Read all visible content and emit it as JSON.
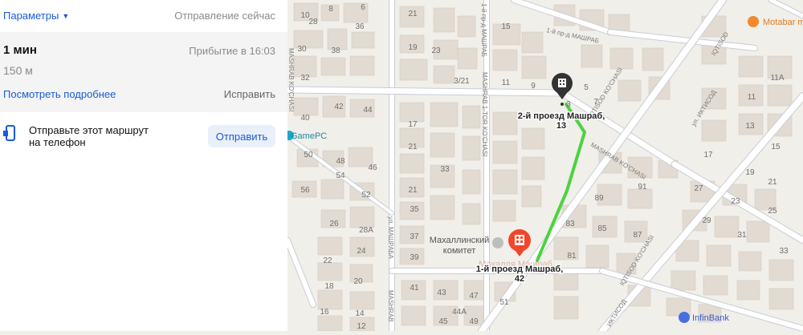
{
  "panel": {
    "params_label": "Параметры",
    "depart_label": "Отправление сейчас",
    "route": {
      "duration": "1 мин",
      "arrival": "Прибытие в 16:03",
      "distance": "150 м",
      "details_link": "Посмотреть подробнее",
      "fix_link": "Исправить"
    },
    "send": {
      "line1": "Отправьте этот маршрут",
      "line2": "на телефон",
      "button": "Отправить"
    }
  },
  "map": {
    "pois": {
      "gamepc": "GamePC",
      "motabar": "Motabar mebel",
      "infinbank": "InfinBank",
      "mahalla_line1": "Махаллинский",
      "mahalla_line2": "комитет",
      "mahalla_ghost": "Махалля Машраб"
    },
    "start": {
      "line1": "2-й проезд Машраб,",
      "line2": "13"
    },
    "finish": {
      "line1": "1-й проезд Машраб,",
      "line2": "42"
    },
    "streets": {
      "pr_mashrab_2": "1-й пр-д МАШРАБ",
      "pr_mashrab_top": "1-й пр-д МАШРАБ",
      "mashrab_kochasi_a": "MASHRAB KO'CHASI",
      "mashrab_kochasi_b": "MASHRAB KO'CHASI",
      "mashrab_1tor": "MASHRAB 1-TOR KO'CHASI",
      "mashraba": "ул. МАШРАБА",
      "mashraba_2": "MASHRAB",
      "iqtisod_kochasi": "IQTISOD KO'CHASI",
      "iqtisod_kochasi_2": "IQTISOD KO'CHASI",
      "iqtisod": "IQTISOD",
      "ul_iktisod": "ул. ИКТИСОД",
      "iqtisod_bottom": "ИКТИСОД"
    },
    "numbers": {
      "n1": "21",
      "n2": "23",
      "n3": "3/21",
      "n4": "19",
      "n5": "21",
      "n6": "21",
      "n7": "17",
      "n8": "15",
      "n9": "11",
      "n10": "9",
      "n11": "7",
      "n12": "5",
      "n13": "3",
      "n14": "28",
      "n15": "30",
      "n16": "32",
      "n17": "38",
      "n18": "36",
      "n19": "40",
      "n20": "42",
      "n21": "44",
      "n22": "44A",
      "n23": "46",
      "n24": "48",
      "n25": "50",
      "n26": "52",
      "n27": "54",
      "n28": "56",
      "n29": "10",
      "n30": "8",
      "n31": "6",
      "n32": "33",
      "n33": "35",
      "n34": "37",
      "n35": "39",
      "n36": "41",
      "n37": "43",
      "n38": "45",
      "n39": "47",
      "n40": "49",
      "n41": "51",
      "n42": "28A",
      "n43": "26",
      "n44": "24",
      "n45": "22",
      "n46": "20",
      "n47": "18",
      "n48": "16",
      "n49": "14",
      "n50": "12",
      "n51": "11A",
      "n52": "11",
      "n53": "13",
      "n54": "15",
      "n55": "17",
      "n56": "19",
      "n57": "21",
      "n58": "23",
      "n59": "25",
      "n60": "27",
      "n61": "29",
      "n62": "31",
      "n63": "33",
      "n64": "83",
      "n65": "85",
      "n66": "87",
      "n67": "89",
      "n68": "91",
      "n69": "81"
    }
  },
  "colors": {
    "link": "#1a5bd6",
    "route": "#4bd33f",
    "marker_dark": "#333333",
    "marker_finish": "#f2462c"
  }
}
